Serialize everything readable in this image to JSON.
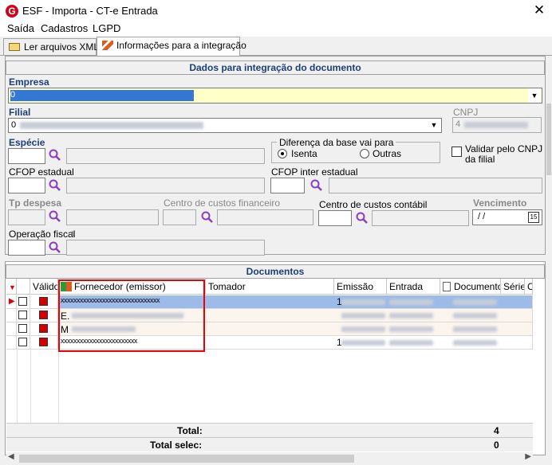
{
  "window": {
    "title": "ESF - Importa - CT-e Entrada",
    "icon_letter": "G",
    "close": "✕"
  },
  "menu": [
    "Saída",
    "Cadastros",
    "LGPD"
  ],
  "tabs": [
    {
      "label": "Ler arquivos XML",
      "icon": "folder-icon"
    },
    {
      "label": "Informações para a integração",
      "icon": "feather-icon"
    }
  ],
  "form": {
    "section_title": "Dados para integração do documento",
    "empresa": {
      "label": "Empresa",
      "value": "0"
    },
    "filial": {
      "label": "Filial",
      "value": "0"
    },
    "cnpj": {
      "label": "CNPJ",
      "value": "4"
    },
    "especie": {
      "label": "Espécie"
    },
    "diferenca": {
      "label": "Diferença da base vai para",
      "options": [
        "Isenta",
        "Outras"
      ],
      "selected": "Isenta"
    },
    "validar_cnpj": {
      "label_line1": "Validar pelo CNPJ",
      "label_line2": "da filial",
      "checked": false
    },
    "cfop_estadual": {
      "label": "CFOP estadual"
    },
    "cfop_inter": {
      "label": "CFOP inter estadual"
    },
    "tp_despesa": {
      "label": "Tp despesa"
    },
    "cc_financeiro": {
      "label": "Centro de custos financeiro"
    },
    "cc_contabil": {
      "label": "Centro de custos contábil"
    },
    "vencimento": {
      "label": "Vencimento",
      "value": " / /",
      "calendar_day": "15"
    },
    "operacao_fiscal": {
      "label": "Operação fiscal"
    }
  },
  "grid": {
    "title": "Documentos",
    "columns": [
      "Válido",
      "Fornecedor (emissor)",
      "Tomador",
      "Emissão",
      "Entrada",
      "Documento",
      "Série",
      "C"
    ],
    "rows": [
      {
        "fornecedor": "xxxxxxxxxxxxxxxxxxxxxxxxxxxxxxx",
        "emissao_prefix": "1",
        "selected": true
      },
      {
        "fornecedor": "E.",
        "emissao_prefix": "",
        "selected": false
      },
      {
        "fornecedor": "M",
        "emissao_prefix": "",
        "selected": false
      },
      {
        "fornecedor": "xxxxxxxxxxxxxxxxxxxxxxxx",
        "emissao_prefix": "1",
        "selected": false
      }
    ],
    "footer": [
      {
        "label": "Total:",
        "value": "4"
      },
      {
        "label": "Total selec:",
        "value": "0"
      }
    ]
  }
}
